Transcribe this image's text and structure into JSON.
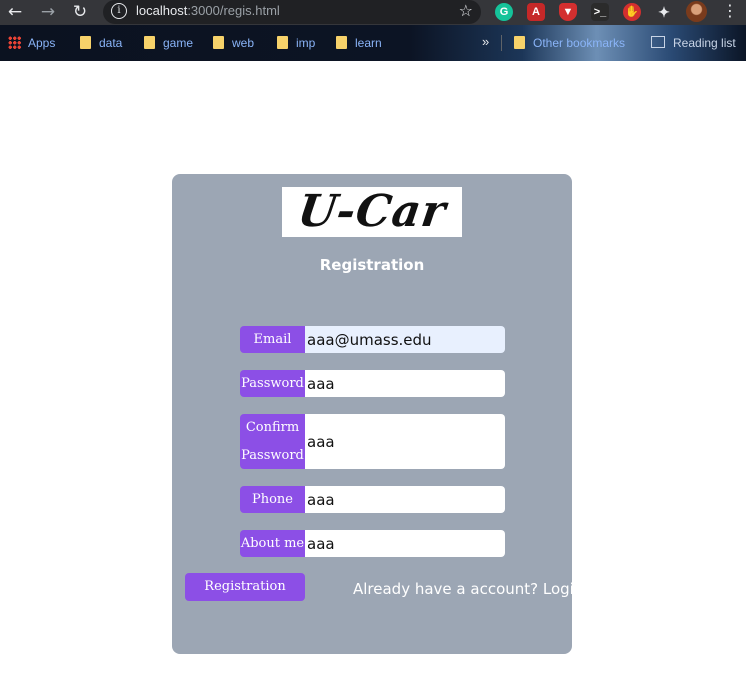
{
  "browser": {
    "url_host": "localhost",
    "url_rest": ":3000/regis.html",
    "extensions": [
      "grammarly-icon",
      "pdf-icon",
      "shield-icon",
      "terminal-icon",
      "hand-icon",
      "puzzle-icon",
      "profile-avatar"
    ],
    "bookmarks": [
      {
        "label": "Apps",
        "icon": "apps-grid-icon"
      },
      {
        "label": "data",
        "icon": "folder-icon"
      },
      {
        "label": "game",
        "icon": "folder-icon"
      },
      {
        "label": "web",
        "icon": "folder-icon"
      },
      {
        "label": "imp",
        "icon": "folder-icon"
      },
      {
        "label": "learn",
        "icon": "folder-icon"
      }
    ],
    "other_bookmarks": "Other bookmarks",
    "reading_list": "Reading list"
  },
  "page": {
    "logo_text": "U-Car",
    "title": "Registration",
    "fields": {
      "email": {
        "label": "Email",
        "value": "aaa@umass.edu"
      },
      "password": {
        "label": "Password",
        "value": "aaa"
      },
      "confirm": {
        "label_line1": "Confirm",
        "label_line2": "Password",
        "value": "aaa"
      },
      "phone": {
        "label": "Phone",
        "value": "aaa"
      },
      "about": {
        "label": "About me",
        "value": "aaa"
      }
    },
    "register_button": "Registration",
    "login_link": "Already have a account? Login!"
  },
  "colors": {
    "card_bg": "#9ca6b4",
    "label_bg": "#8c4fe6",
    "autofill_bg": "#e8f0fe"
  }
}
